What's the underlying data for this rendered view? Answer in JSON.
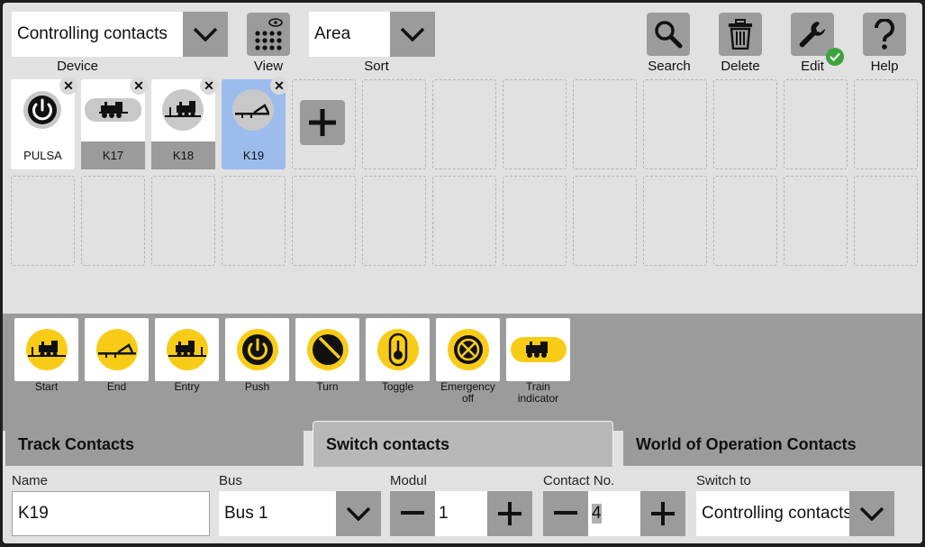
{
  "toolbar": {
    "device_value": "Controlling contacts",
    "device_caption": "Device",
    "view_caption": "View",
    "sort_value": "Area",
    "sort_caption": "Sort",
    "search_caption": "Search",
    "delete_caption": "Delete",
    "edit_caption": "Edit",
    "help_caption": "Help"
  },
  "contacts": [
    {
      "label": "PULSA",
      "icon": "power-icon"
    },
    {
      "label": "K17",
      "icon": "train-icon"
    },
    {
      "label": "K18",
      "icon": "train-entry-icon"
    },
    {
      "label": "K19",
      "icon": "buffer-stop-icon"
    }
  ],
  "palette": [
    {
      "label": "Start",
      "icon": "train-start-icon"
    },
    {
      "label": "End",
      "icon": "buffer-stop-icon"
    },
    {
      "label": "Entry",
      "icon": "train-entry-icon"
    },
    {
      "label": "Push",
      "icon": "power-icon"
    },
    {
      "label": "Turn",
      "icon": "turn-icon"
    },
    {
      "label": "Toggle",
      "icon": "toggle-icon"
    },
    {
      "label": "Emergency off",
      "icon": "emergency-off-icon"
    },
    {
      "label": "Train indicator",
      "icon": "train-indicator-icon"
    }
  ],
  "tabs": [
    "Track Contacts",
    "Switch contacts",
    "World of Operation Contacts"
  ],
  "form": {
    "name_label": "Name",
    "name_value": "K19",
    "bus_label": "Bus",
    "bus_value": "Bus 1",
    "modul_label": "Modul",
    "modul_value": "1",
    "contact_label": "Contact No.",
    "contact_value": "4",
    "switch_label": "Switch to",
    "switch_value": "Controlling contacts"
  },
  "colors": {
    "accent_yellow": "#f8cc16",
    "selected_blue": "#9bbcec",
    "check_green": "#3ea33e"
  }
}
